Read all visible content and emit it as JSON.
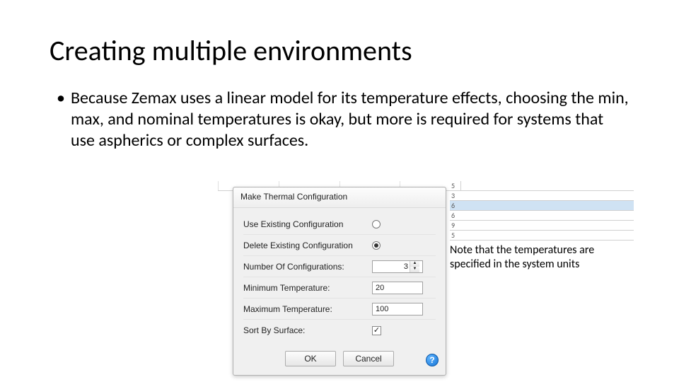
{
  "slide": {
    "title": "Creating multiple environments",
    "bullet1": "Because Zemax uses a linear model for its temperature effects, choosing the min, max, and nominal temperatures is okay, but more is required for systems that use aspherics or complex surfaces.",
    "note": "Note that the temperatures are specified in the system units"
  },
  "dialog": {
    "title": "Make Thermal Configuration",
    "rows": {
      "use_existing": {
        "label": "Use Existing Configuration",
        "checked": false
      },
      "delete_existing": {
        "label": "Delete Existing Configuration",
        "checked": true
      },
      "num_configs": {
        "label": "Number Of Configurations:",
        "value": "3"
      },
      "min_temp": {
        "label": "Minimum Temperature:",
        "value": "20"
      },
      "max_temp": {
        "label": "Maximum Temperature:",
        "value": "100"
      },
      "sort_surface": {
        "label": "Sort By Surface:",
        "checked": true
      }
    },
    "buttons": {
      "ok": "OK",
      "cancel": "Cancel"
    },
    "help": "?"
  },
  "frag_digits": [
    "5",
    "3",
    "6",
    "6",
    "9",
    "5"
  ]
}
